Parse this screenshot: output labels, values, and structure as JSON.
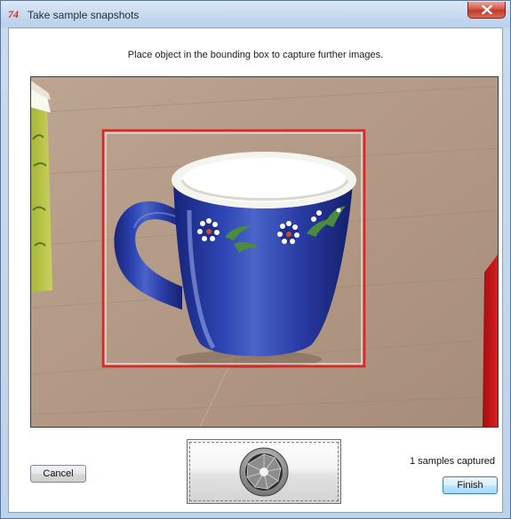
{
  "window": {
    "title": "Take sample snapshots",
    "app_icon_text": "74"
  },
  "main": {
    "instruction": "Place object in the bounding box to capture further images.",
    "preview": {
      "bounding_box_color": "#e32222",
      "bounding_box_icon": "red-rectangle"
    }
  },
  "footer": {
    "cancel_label": "Cancel",
    "capture_icon": "camera-shutter-icon",
    "status_text": "1 samples captured",
    "finish_label": "Finish"
  },
  "colors": {
    "close_button": "#c13a2b",
    "mug_blue": "#24339a",
    "table": "#b49a86"
  }
}
